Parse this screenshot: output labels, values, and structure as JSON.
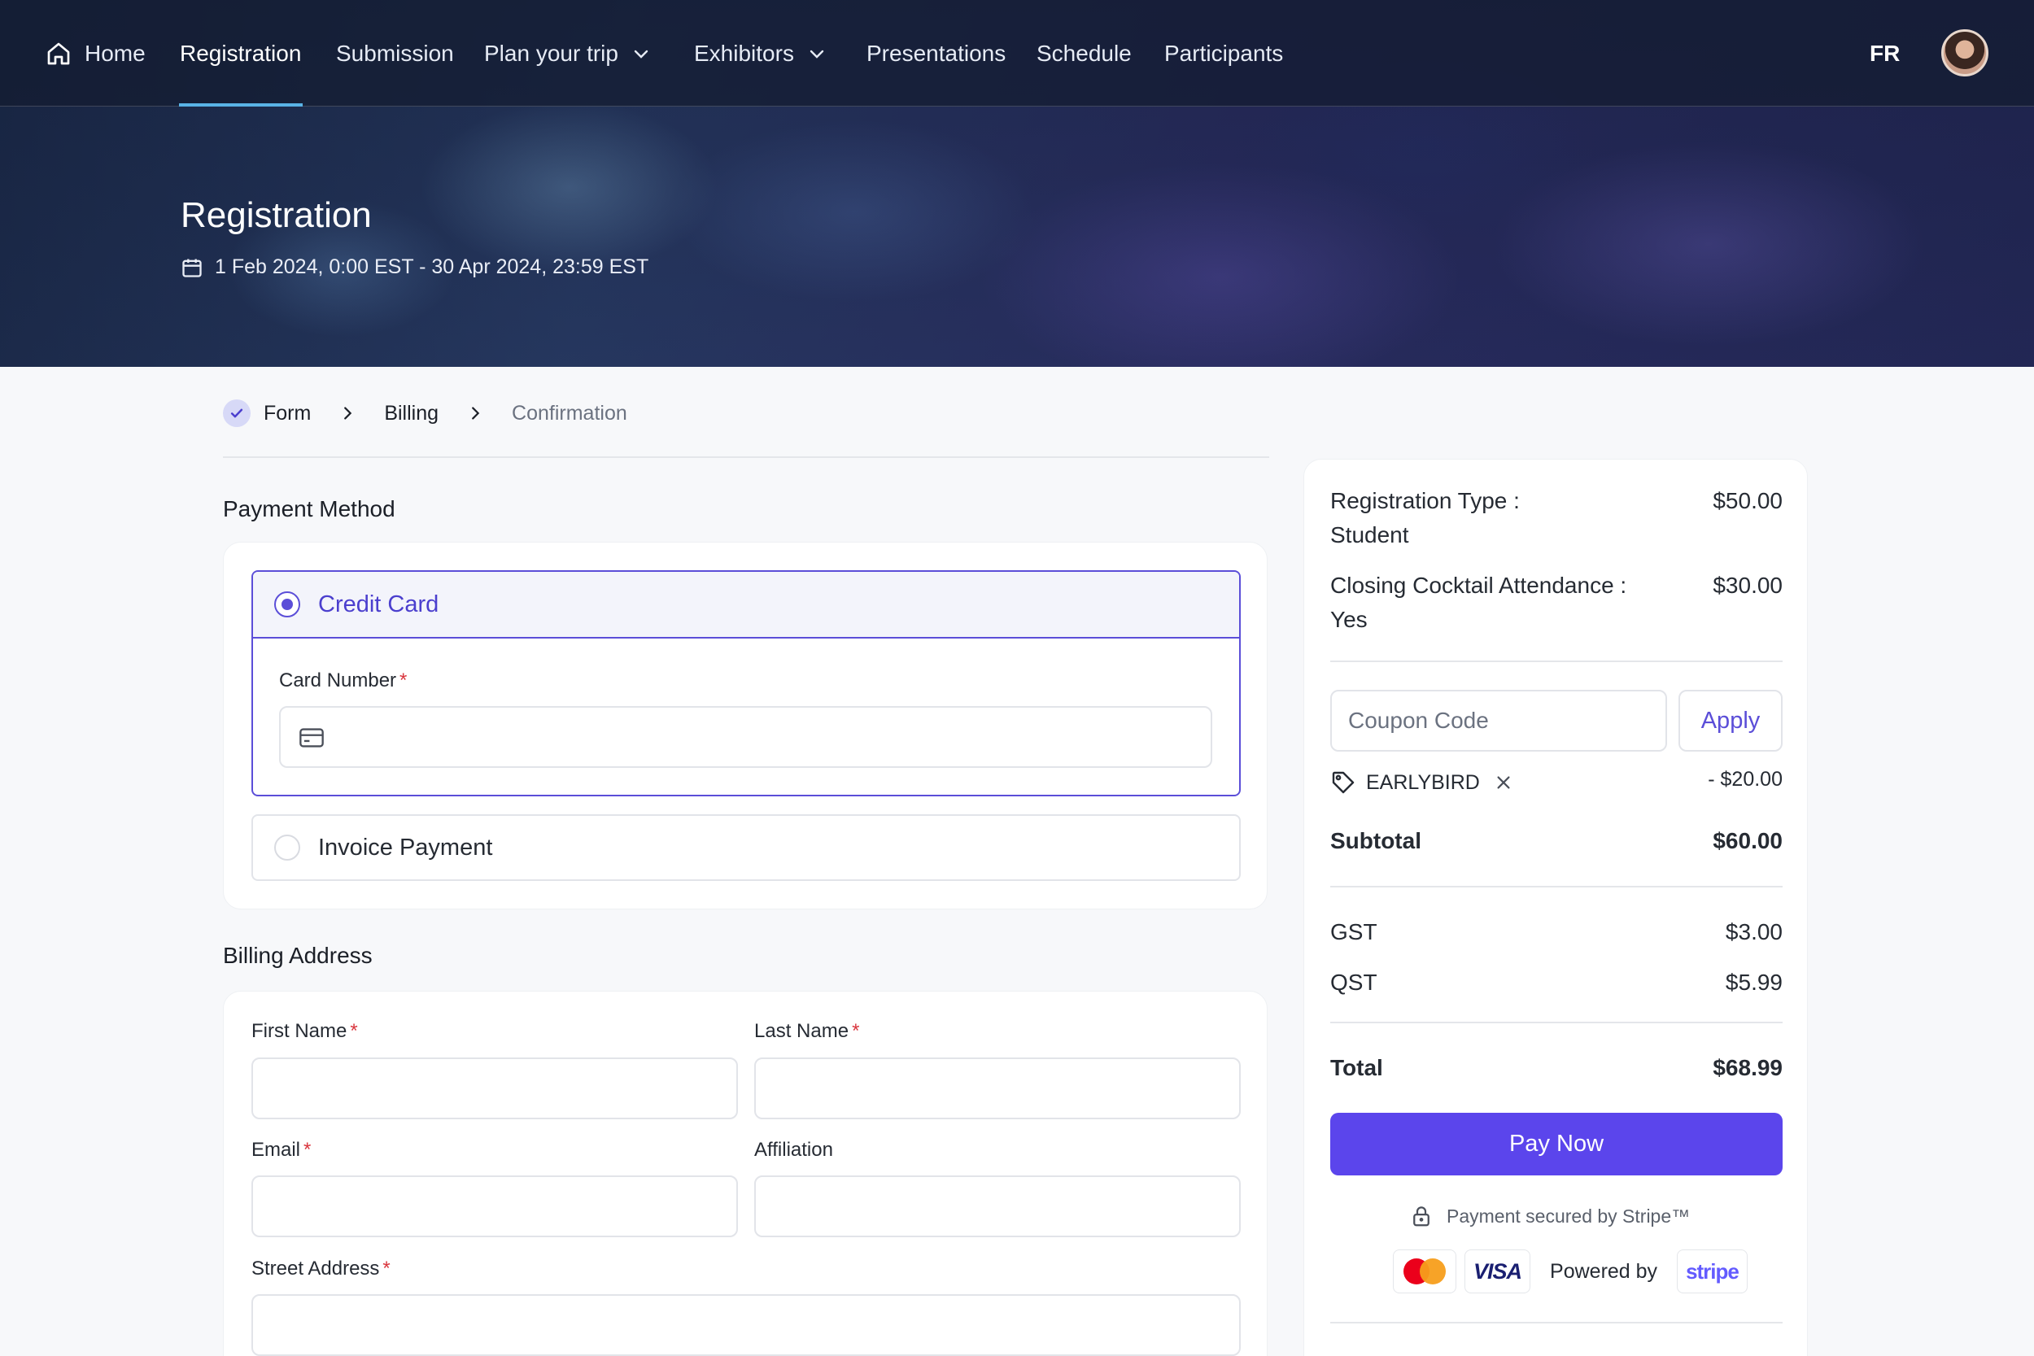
{
  "nav": {
    "items": [
      {
        "label": "Home"
      },
      {
        "label": "Registration"
      },
      {
        "label": "Submission"
      },
      {
        "label": "Plan your trip"
      },
      {
        "label": "Exhibitors"
      },
      {
        "label": "Presentations"
      },
      {
        "label": "Schedule"
      },
      {
        "label": "Participants"
      }
    ],
    "language": "FR"
  },
  "hero": {
    "title": "Registration",
    "date_range": "1 Feb 2024, 0:00 EST - 30 Apr 2024, 23:59 EST"
  },
  "stepper": {
    "steps": [
      {
        "label": "Form",
        "state": "done"
      },
      {
        "label": "Billing",
        "state": "current"
      },
      {
        "label": "Confirmation",
        "state": "upcoming"
      }
    ]
  },
  "payment": {
    "title": "Payment Method",
    "options": [
      {
        "label": "Credit Card",
        "selected": true
      },
      {
        "label": "Invoice Payment",
        "selected": false
      }
    ],
    "card_number_label": "Card Number",
    "required_mark": "*"
  },
  "billing": {
    "title": "Billing Address",
    "fields": {
      "first_name": "First Name",
      "last_name": "Last Name",
      "email": "Email",
      "affiliation": "Affiliation",
      "street": "Street Address"
    }
  },
  "summary": {
    "lines": [
      {
        "label": "Registration Type :",
        "value": "Student",
        "amount": "$50.00"
      },
      {
        "label": "Closing Cocktail Attendance :",
        "value": "Yes",
        "amount": "$30.00"
      }
    ],
    "coupon_placeholder": "Coupon Code",
    "apply_label": "Apply",
    "applied_coupon": "EARLYBIRD",
    "discount": "- $20.00",
    "subtotal_label": "Subtotal",
    "subtotal": "$60.00",
    "taxes": [
      {
        "label": "GST",
        "amount": "$3.00"
      },
      {
        "label": "QST",
        "amount": "$5.99"
      }
    ],
    "total_label": "Total",
    "total": "$68.99",
    "pay_label": "Pay Now",
    "secure_text": "Payment secured by Stripe™",
    "visa_label": "VISA",
    "powered_by": "Powered by",
    "stripe_label": "stripe"
  },
  "colors": {
    "accent": "#5b45ec",
    "nav_underline": "#59b3e6",
    "required": "#d9363e"
  }
}
